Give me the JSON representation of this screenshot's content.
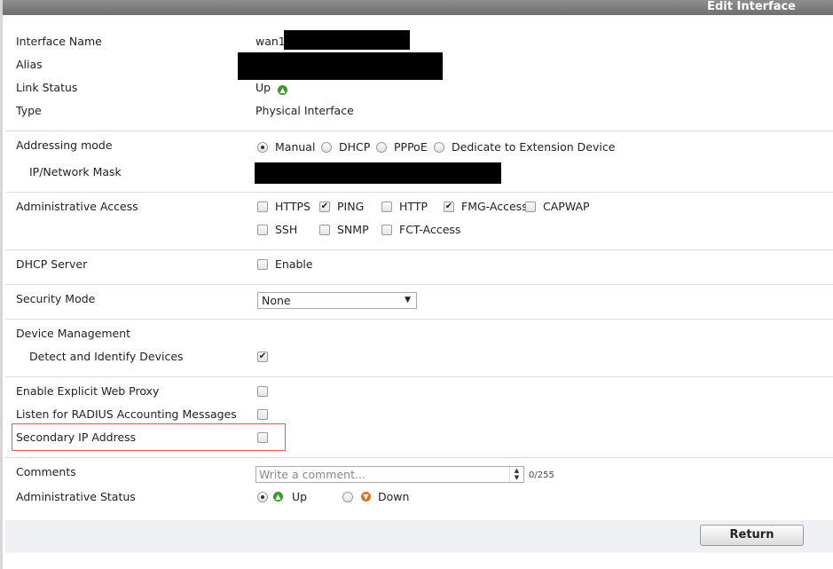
{
  "header": {
    "title": "Edit Interface"
  },
  "fields": {
    "interface_name": {
      "label": "Interface Name",
      "value": "wan1"
    },
    "alias": {
      "label": "Alias"
    },
    "link_status": {
      "label": "Link Status",
      "value": "Up",
      "icon": "up-arrow-icon"
    },
    "type": {
      "label": "Type",
      "value": "Physical Interface"
    },
    "addressing_mode": {
      "label": "Addressing mode",
      "options": [
        "Manual",
        "DHCP",
        "PPPoE",
        "Dedicate to Extension Device"
      ],
      "selected": "Manual"
    },
    "ip_mask": {
      "label": "IP/Network Mask"
    },
    "admin_access": {
      "label": "Administrative Access",
      "options": [
        {
          "label": "HTTPS",
          "checked": false
        },
        {
          "label": "PING",
          "checked": true
        },
        {
          "label": "HTTP",
          "checked": false
        },
        {
          "label": "FMG-Access",
          "checked": true
        },
        {
          "label": "CAPWAP",
          "checked": false
        },
        {
          "label": "SSH",
          "checked": false
        },
        {
          "label": "SNMP",
          "checked": false
        },
        {
          "label": "FCT-Access",
          "checked": false
        }
      ]
    },
    "dhcp_server": {
      "label": "DHCP Server",
      "option": "Enable",
      "checked": false
    },
    "security_mode": {
      "label": "Security Mode",
      "value": "None"
    },
    "device_management": {
      "label": "Device Management"
    },
    "detect_devices": {
      "label": "Detect and Identify Devices",
      "checked": true
    },
    "explicit_proxy": {
      "label": "Enable Explicit Web Proxy",
      "checked": false
    },
    "radius": {
      "label": "Listen for RADIUS Accounting Messages",
      "checked": false
    },
    "secondary_ip": {
      "label": "Secondary IP Address",
      "checked": false
    },
    "comments": {
      "label": "Comments",
      "placeholder": "Write a comment...",
      "counter": "0/255"
    },
    "admin_status": {
      "label": "Administrative Status",
      "options": [
        "Up",
        "Down"
      ],
      "selected": "Up"
    }
  },
  "footer": {
    "return_label": "Return"
  },
  "colors": {
    "highlight_border": "#e05a5a",
    "status_up": "#3a9a2a",
    "status_down": "#e0701a"
  }
}
